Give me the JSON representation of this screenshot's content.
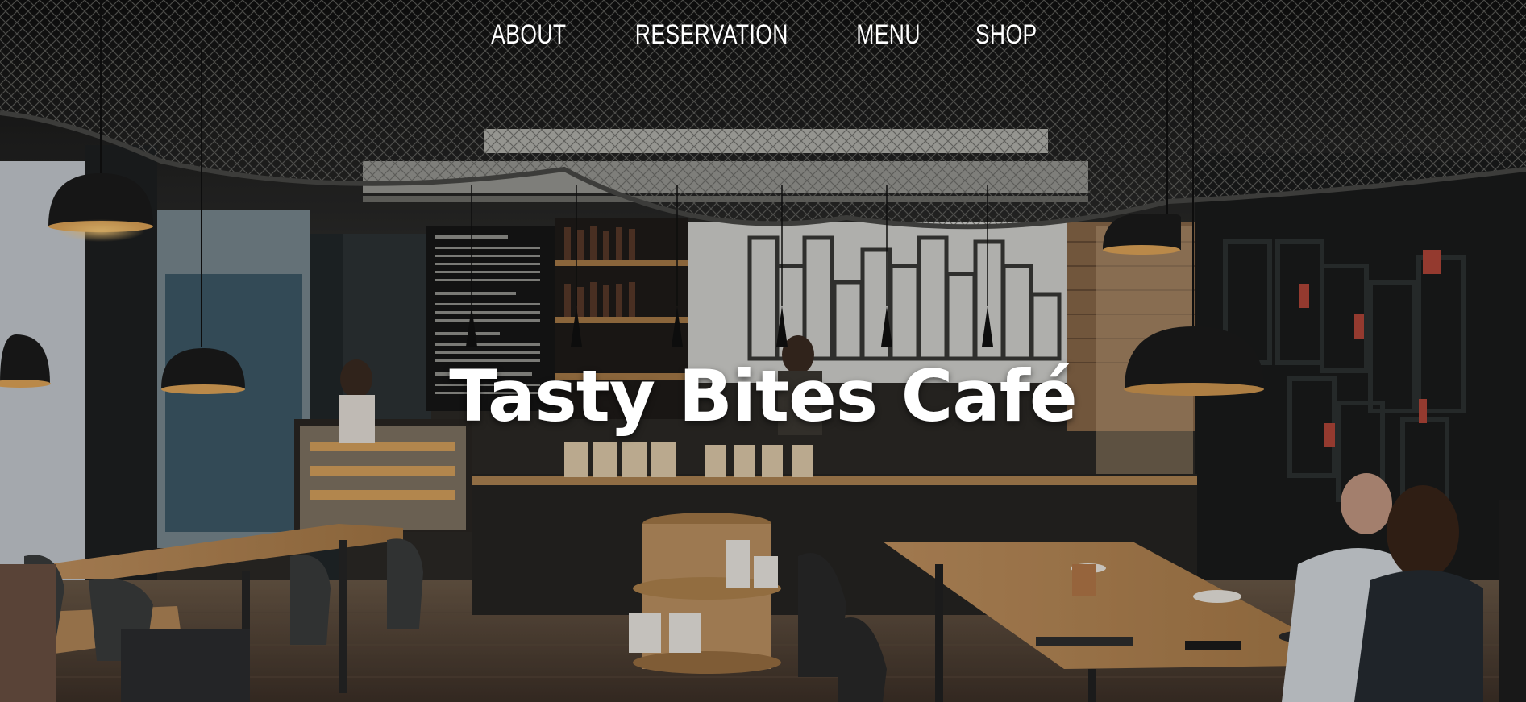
{
  "nav": {
    "items": [
      {
        "label": "ABOUT"
      },
      {
        "label": "RESERVATION"
      },
      {
        "label": "MENU"
      },
      {
        "label": "SHOP"
      }
    ]
  },
  "hero": {
    "title": "Tasty Bites Café",
    "background_image": "cafe-interior-photo"
  },
  "colors": {
    "text": "#ffffff",
    "wood": "#b98a52",
    "dark": "#1b1a17"
  }
}
